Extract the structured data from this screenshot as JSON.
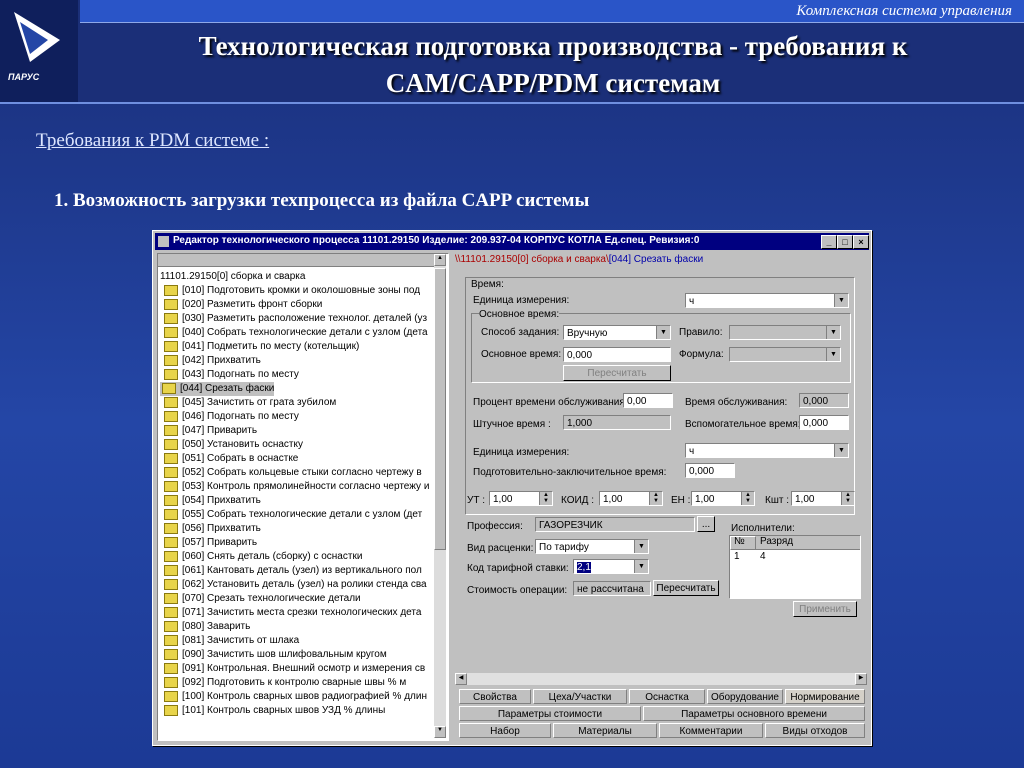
{
  "header": {
    "brand": "Комплексная система управления",
    "logo_text": "ПАРУС",
    "title_line1": "Технологическая подготовка производства - требования к",
    "title_line2": "CAM/CAPP/PDM системам"
  },
  "slide": {
    "subtitle": "Требования к PDM системе :",
    "point": "1. Возможность загрузки техпроцесса из файла CAPP системы"
  },
  "window": {
    "title": "Редактор технологического процесса 11101.29150 Изделие: 209.937-04 КОРПУС КОТЛА Ед.спец. Ревизия:0",
    "tree_root": "11101.29150[0] сборка и сварка",
    "tree_items": [
      "[010] Подготовить кромки и околошовные зоны под",
      "[020] Разметить фронт сборки",
      "[030] Разметить расположение технолог. деталей (уз",
      "[040] Собрать технологические детали с узлом (дета",
      "[041] Подметить по месту  (котельщик)",
      "[042] Прихватить",
      "[043] Подогнать по месту",
      "[044] Срезать фаски",
      "[045] Зачистить от грата зубилом",
      "[046] Подогнать по месту",
      "[047] Приварить",
      "[050] Установить оснастку",
      "[051] Собрать в оснастке",
      "[052] Собрать кольцевые стыки согласно чертежу в",
      "[053] Контроль прямолинейности согласно чертежу и",
      "[054] Прихватить",
      "[055] Собрать технологические детали с узлом (дет",
      "[056] Прихватить",
      "[057] Приварить",
      "[060] Снять деталь (сборку) с оснастки",
      "[061] Кантовать деталь (узел) из вертикального пол",
      "[062] Установить деталь (узел) на ролики стенда сва",
      "[070] Срезать технологические детали",
      "[071] Зачистить места срезки технологических дета",
      "[080] Заварить",
      "[081] Зачистить от шлака",
      "[090] Зачистить шов шлифовальным кругом",
      "[091] Контрольная. Внешний осмотр и измерения св",
      "[092] Подготовить к контролю сварные швы     % м",
      "[100] Контроль сварных швов радиографией     % длин",
      "[101] Контроль сварных швов  УЗД    % длины"
    ],
    "panel_header_prefix": "\\\\11101.29150[0] сборка и сварка\\",
    "panel_header_sel": "[044] Срезать фаски",
    "time_group": "Время:",
    "unit_label": "Единица измерения:",
    "unit_value": "ч",
    "main_time_group": "Основное время:",
    "method_label": "Способ задания:",
    "method_value": "Вручную",
    "rule_label": "Правило:",
    "main_time_label": "Основное время:",
    "main_time_value": "0,000",
    "formula_label": "Формула:",
    "recalc_label": "Пересчитать",
    "percent_label": "Процент времени обслуживания:",
    "percent_value": "0,00",
    "service_label": "Время обслуживания:",
    "service_value": "0,000",
    "piece_label": "Штучное время :",
    "piece_value": "1,000",
    "aux_label": "Вспомогательное время:",
    "aux_value": "0,000",
    "unit2_label": "Единица измерения:",
    "unit2_value": "ч",
    "prep_label": "Подготовительно-заключительное время:",
    "prep_value": "0,000",
    "ut_label": "УТ :",
    "ut_value": "1,00",
    "koid_label": "КОИД :",
    "koid_value": "1,00",
    "en_label": "ЕН :",
    "en_value": "1,00",
    "ksht_label": "Кшт :",
    "ksht_value": "1,00",
    "profession_label": "Профессия:",
    "profession_value": "ГАЗОРЕЗЧИК",
    "profession_btn": "...",
    "pay_label": "Вид расценки:",
    "pay_value": "По тарифу",
    "rate_label": "Код тарифной ставки:",
    "rate_value": "2,1",
    "cost_label": "Стоимость операции:",
    "cost_value": "не рассчитана",
    "cost_btn": "Пересчитать",
    "executors_label": "Исполнители:",
    "exec_cols": [
      "№",
      "Разряд"
    ],
    "exec_rows": [
      [
        "1",
        "4"
      ]
    ],
    "apply_label": "Применить",
    "tabs_row1": [
      "Свойства",
      "Цеха/Участки",
      "Оснастка",
      "Оборудование",
      "Нормирование"
    ],
    "tabs_row2": [
      "Параметры стоимости",
      "Параметры основного времени"
    ],
    "tabs_row3": [
      "Набор",
      "Материалы",
      "Комментарии",
      "Виды отходов"
    ]
  }
}
